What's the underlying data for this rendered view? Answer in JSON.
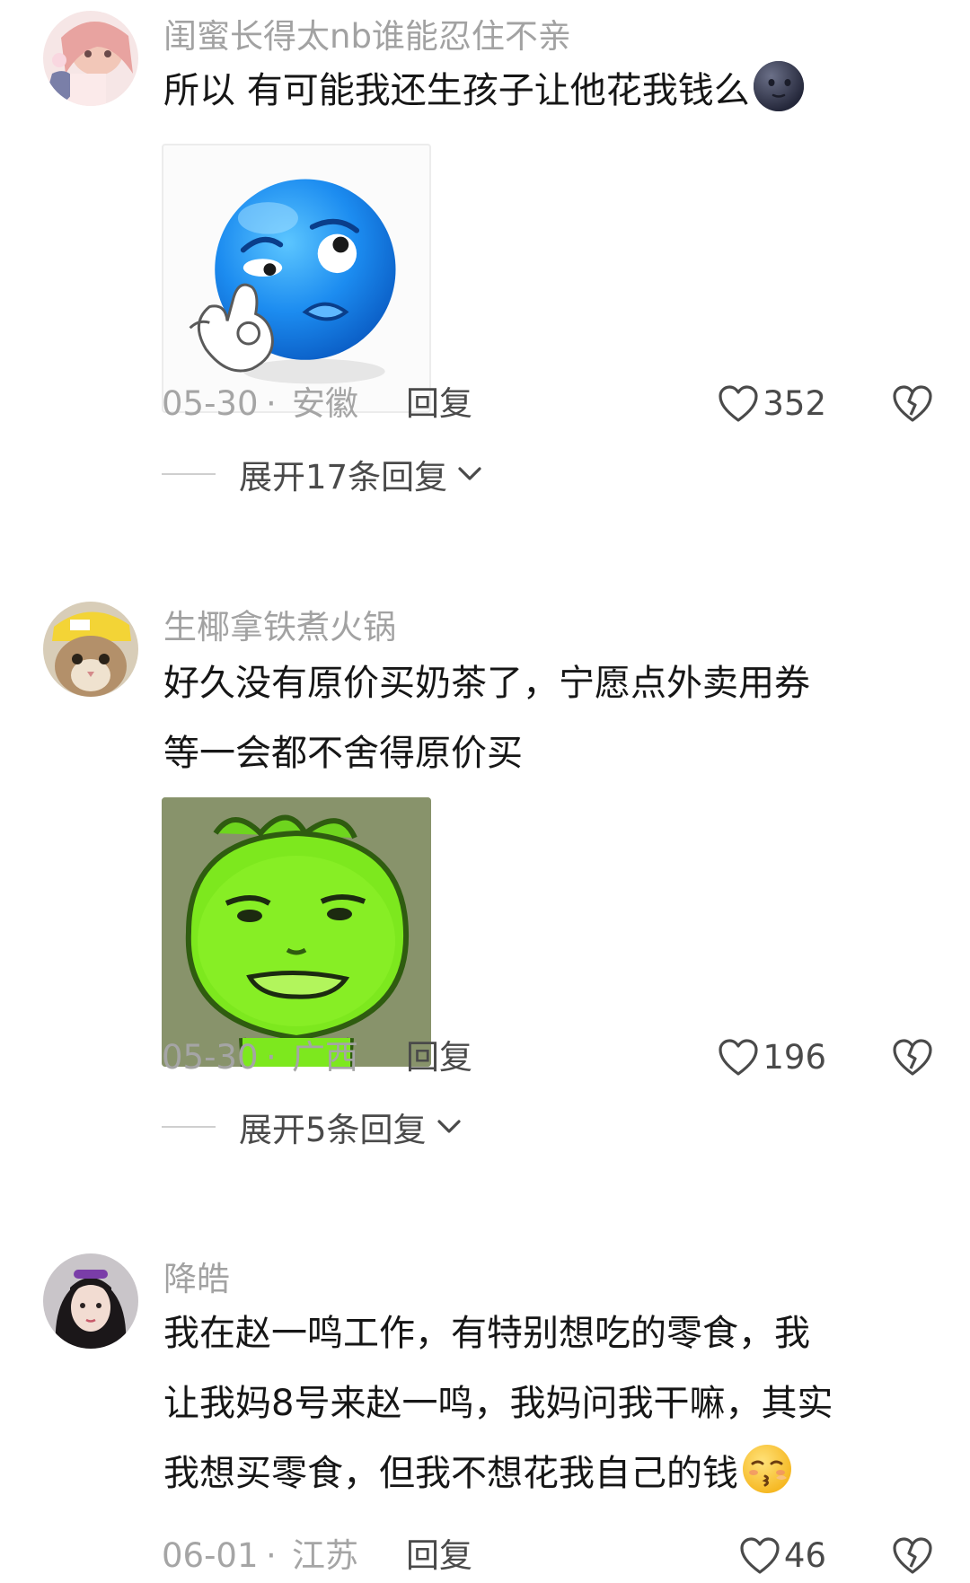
{
  "comments": [
    {
      "username": "闺蜜长得太nb谁能忍住不亲",
      "text": "所以 有可能我还生孩子让他花我钱么",
      "inline_emoji": "new-moon-face-emoji",
      "media": "blue-ok-hand-smiley-sticker",
      "date": "05-30",
      "separator": "·",
      "location": "安徽",
      "reply_label": "回复",
      "likes": "352",
      "expand_label": "展开17条回复"
    },
    {
      "username": "生椰拿铁煮火锅",
      "text_lines": [
        "好久没有原价买奶茶了，宁愿点外卖用券",
        "等一会都不舍得原价买"
      ],
      "media": "green-bean-face-sticker",
      "date": "05-30",
      "separator": "·",
      "location": "广西",
      "reply_label": "回复",
      "likes": "196",
      "expand_label": "展开5条回复"
    },
    {
      "username": "降皓",
      "text_lines": [
        "我在赵一鸣工作，有特别想吃的零食，我",
        "让我妈8号来赵一鸣，我妈问我干嘛，其实",
        "我想买零食，但我不想花我自己的钱"
      ],
      "inline_emoji": "kissing-face-emoji",
      "date": "06-01",
      "separator": "·",
      "location": "江苏",
      "reply_label": "回复",
      "likes": "46"
    }
  ],
  "colors": {
    "username": "#a2a2a2",
    "text": "#161616",
    "meta": "#a5a5a5",
    "action": "#4a4a4a"
  }
}
